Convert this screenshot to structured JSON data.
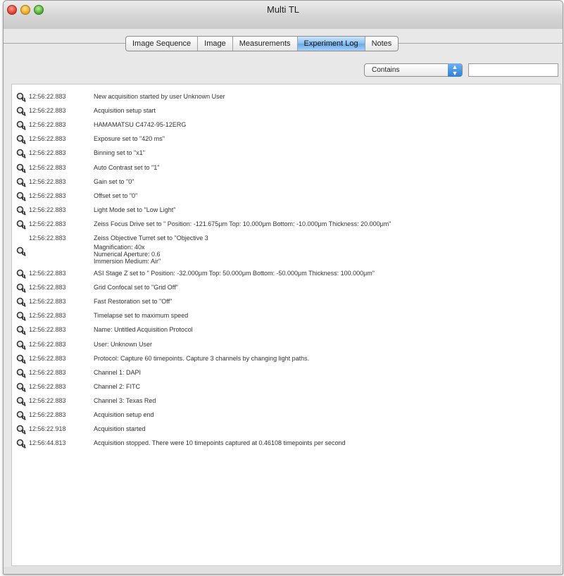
{
  "window": {
    "title": "Multi TL"
  },
  "tabs": [
    {
      "label": "Image Sequence",
      "active": false
    },
    {
      "label": "Image",
      "active": false
    },
    {
      "label": "Measurements",
      "active": false
    },
    {
      "label": "Experiment Log",
      "active": true
    },
    {
      "label": "Notes",
      "active": false
    }
  ],
  "filter": {
    "mode_selected": "Contains",
    "search_value": ""
  },
  "log": {
    "icon": "magnifier-info-icon",
    "entries": [
      {
        "time": "12:56:22.883",
        "message": "New acquisition started by user Unknown User"
      },
      {
        "time": "12:56:22.883",
        "message": "Acquisition setup start"
      },
      {
        "time": "12:56:22.883",
        "message": "HAMAMATSU C4742-95-12ERG"
      },
      {
        "time": "12:56:22.883",
        "message": "Exposure set to \"420 ms\""
      },
      {
        "time": "12:56:22.883",
        "message": "Binning set to \"x1\""
      },
      {
        "time": "12:56:22.883",
        "message": "Auto Contrast set to \"1\""
      },
      {
        "time": "12:56:22.883",
        "message": "Gain set to \"0\""
      },
      {
        "time": "12:56:22.883",
        "message": "Offset set to \"0\""
      },
      {
        "time": "12:56:22.883",
        "message": "Light Mode set to \"Low Light\""
      },
      {
        "time": "12:56:22.883",
        "message": "Zeiss Focus Drive set to \" Position: -121.675μm Top: 10.000μm Bottom: -10.000μm Thickness: 20.000μm\""
      },
      {
        "time": "12:56:22.883",
        "message": "Zeiss Objective Turret set to \"Objective 3"
      },
      {
        "time": "",
        "message": "",
        "sub": [
          "Magnification: 40x",
          "Numerical Aperture: 0.6",
          "Immersion Medium: Air\""
        ]
      },
      {
        "time": "12:56:22.883",
        "message": "ASI Stage Z set to \" Position: -32.000μm Top: 50.000μm Bottom: -50.000μm Thickness: 100.000μm\""
      },
      {
        "time": "12:56:22.883",
        "message": "Grid Confocal set to \"Grid Off\""
      },
      {
        "time": "12:56:22.883",
        "message": "Fast Restoration set to \"Off\""
      },
      {
        "time": "12:56:22.883",
        "message": "Timelapse set to maximum speed"
      },
      {
        "time": "12:56:22.883",
        "message": "Name: Untitled Acquisition Protocol"
      },
      {
        "time": "12:56:22.883",
        "message": "User: Unknown User"
      },
      {
        "time": "12:56:22.883",
        "message": "Protocol: Capture 60 timepoints. Capture 3 channels by changing light paths."
      },
      {
        "time": "12:56:22.883",
        "message": "Channel 1: DAPI"
      },
      {
        "time": "12:56:22.883",
        "message": "Channel 2: FITC"
      },
      {
        "time": "12:56:22.883",
        "message": "Channel 3: Texas Red"
      },
      {
        "time": "12:56:22.883",
        "message": "Acquisition setup end"
      },
      {
        "time": "12:56:22.918",
        "message": "Acquisition started"
      },
      {
        "time": "12:56:44.813",
        "message": "Acquisition stopped. There were 10 timepoints captured at 0.46108 timepoints per second"
      }
    ]
  }
}
